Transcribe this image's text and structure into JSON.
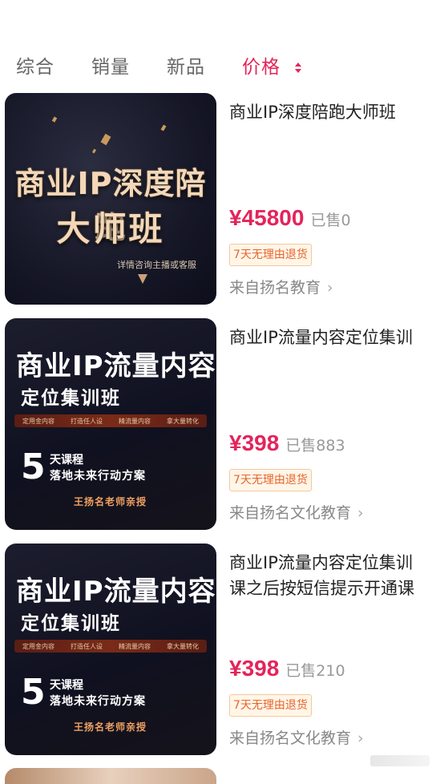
{
  "tabs": [
    {
      "label": "综合"
    },
    {
      "label": "销量"
    },
    {
      "label": "新品"
    },
    {
      "label": "价格"
    }
  ],
  "accent_color": "#e4245a",
  "items": [
    {
      "thumb_line1": "商业IP深度陪跑",
      "thumb_line2": "大师班",
      "thumb_small": "详情咨询主播或客服",
      "title": "商业IP深度陪跑大师班",
      "price": "¥45800",
      "sold": "已售0",
      "badge": "7天无理由退货",
      "shop": "来自扬名教育"
    },
    {
      "thumb_title": "商业IP流量内容",
      "thumb_sub": "定位集训班",
      "thumb_tags": [
        "定用金内容",
        "打造任人设",
        "精流量内容",
        "拿大量转化"
      ],
      "thumb_num": "5",
      "thumb_days": "天课程",
      "thumb_plan": "落地未来行动方案",
      "thumb_teacher": "王扬名老师亲授",
      "title": "商业IP流量内容定位集训",
      "price": "¥398",
      "sold": "已售883",
      "badge": "7天无理由退货",
      "shop": "来自扬名文化教育"
    },
    {
      "thumb_title": "商业IP流量内容",
      "thumb_sub": "定位集训班",
      "thumb_tags": [
        "定用金内容",
        "打造任人设",
        "精流量内容",
        "拿大量转化"
      ],
      "thumb_num": "5",
      "thumb_days": "天课程",
      "thumb_plan": "落地未来行动方案",
      "thumb_teacher": "王扬名老师亲授",
      "title": "商业IP流量内容定位集训\n课之后按短信提示开通课",
      "price": "¥398",
      "sold": "已售210",
      "badge": "7天无理由退货",
      "shop": "来自扬名文化教育"
    }
  ]
}
